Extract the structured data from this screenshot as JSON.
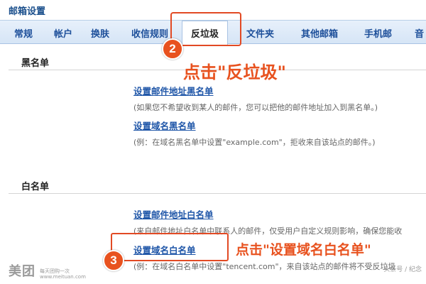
{
  "header": {
    "title": "邮箱设置"
  },
  "tabs": [
    {
      "label": "常规",
      "active": false
    },
    {
      "label": "帐户",
      "active": false
    },
    {
      "label": "换肤",
      "active": false
    },
    {
      "label": "收信规则",
      "active": false
    },
    {
      "label": "反垃圾",
      "active": true
    },
    {
      "label": "文件夹",
      "active": false
    },
    {
      "label": "其他邮箱",
      "active": false
    },
    {
      "label": "手机邮",
      "active": false
    },
    {
      "label": "音",
      "active": false
    }
  ],
  "blacklist": {
    "title": "黑名单",
    "email_link": "设置邮件地址黑名单",
    "email_desc": "(如果您不希望收到某人的邮件，您可以把他的邮件地址加入到黑名单。)",
    "domain_link": "设置域名黑名单",
    "domain_desc": "(例：在域名黑名单中设置\"example.com\"，拒收来自该站点的邮件。)"
  },
  "whitelist": {
    "title": "白名单",
    "email_link": "设置邮件地址白名单",
    "email_desc": "(来自邮件地址白名单中联系人的邮件，仅受用户自定义规则影响，确保您能收",
    "domain_link": "设置域名白名单",
    "domain_desc": "(例：在域名白名单中设置\"tencent.com\"，来自该站点的邮件将不受反垃圾"
  },
  "annotations": {
    "step2_number": "2",
    "step2_text": "点击\"反垃圾\"",
    "step3_number": "3",
    "step3_text": "点击\"设置域名白名单\""
  },
  "watermark": {
    "logo": "美团",
    "tagline_1": "每天团购一次",
    "tagline_2": "www.meituan.com",
    "right": "头条号 / 纪念"
  },
  "colors": {
    "accent": "#e8521f",
    "link": "#1f56a8",
    "tab_text": "#1d4f9a"
  }
}
